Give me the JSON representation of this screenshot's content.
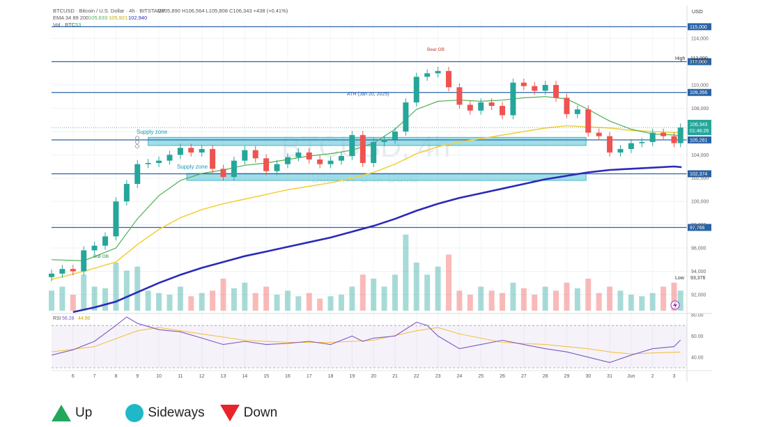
{
  "header": {
    "symbol_line": "BTCUSD · Bitcoin / U.S. Dollar · 4h · BITSTAMP",
    "ohlc": "O105,890  H106,564  L105,808  C106,343  +438 (+0.41%)",
    "ema_label": "EMA 34 89 200",
    "ema_values": [
      "105,633",
      "105,921",
      "102,940"
    ],
    "vol_label": "Vol · BTC",
    "vol_value": "53",
    "currency": "USD"
  },
  "watermark": {
    "main": "BTCUSD, 4h",
    "sub": "Bitcoin / U.S. Dollar"
  },
  "annotations": {
    "bear_ob": "Bear OB",
    "bull_ob": "Bull OB",
    "ath": "ATH (Jan 20, 2025)",
    "supply_zone_1": "Supply zone",
    "supply_zone_2": "Supply zone",
    "high_label": "High",
    "low_label": "Low"
  },
  "legend": {
    "up": "Up",
    "sideways": "Sideways",
    "down": "Down"
  },
  "colors": {
    "up_candle": "#26a69a",
    "down_candle": "#ef5350",
    "ema34": "#4caf50",
    "ema89": "#f4d03f",
    "ema200": "#2a2ab8",
    "level_line": "#2962a6",
    "zone_fill": "#7fd3e0",
    "rsi_line": "#7e57c2",
    "rsi_ma": "#f5c242",
    "legend_up": "#22a85a",
    "legend_sideways": "#1fb8c8",
    "legend_down": "#e8242a"
  },
  "chart_data": {
    "type": "line",
    "price_axis": {
      "ylim": [
        90500,
        115500
      ],
      "ticks": [
        92000,
        94000,
        96000,
        98000,
        100000,
        102000,
        104000,
        106000,
        108000,
        110000,
        112000,
        114000
      ],
      "tick_labels": [
        "92,000",
        "94,000",
        "96,000",
        "98,000",
        "100,000",
        "102,000",
        "104,000",
        "106,000",
        "108,000",
        "110,000",
        "112,000",
        "114,000"
      ]
    },
    "date_axis": {
      "labels": [
        "6",
        "7",
        "8",
        "9",
        "10",
        "11",
        "12",
        "13",
        "14",
        "15",
        "16",
        "17",
        "18",
        "19",
        "20",
        "21",
        "22",
        "23",
        "24",
        "25",
        "26",
        "27",
        "28",
        "29",
        "30",
        "31",
        "Jun",
        "2",
        "3"
      ]
    },
    "levels": [
      {
        "value": 115000,
        "label": "115,000"
      },
      {
        "value": 112000,
        "label": "112,000"
      },
      {
        "value": 109356,
        "label": "109,356"
      },
      {
        "value": 105281,
        "label": "105,281"
      },
      {
        "value": 102374,
        "label": "102,374"
      },
      {
        "value": 97766,
        "label": "97,766"
      }
    ],
    "right_labels": {
      "high_value": "112,000",
      "current_price": "106,343",
      "countdown": "01:46:26",
      "low_value": "93,376"
    },
    "zones": [
      {
        "name": "Supply zone",
        "from_day": 9.5,
        "to_day": 29.9,
        "low": 104800,
        "high": 105500
      },
      {
        "name": "Supply zone",
        "from_day": 11.3,
        "to_day": 29.9,
        "low": 101800,
        "high": 102400
      }
    ],
    "ema34_x": [
      5.0,
      6.5,
      8.0,
      9.0,
      10.0,
      11.0,
      12.0,
      13.0,
      14.0,
      15.0,
      16.0,
      17.0,
      18.0,
      19.0,
      20.0,
      21.0,
      22.0,
      23.0,
      24.0,
      25.0,
      26.0,
      27.0,
      28.0,
      29.0,
      30.0,
      31.0,
      32.0,
      33.0,
      34.0,
      34.35
    ],
    "ema34_y": [
      95000,
      94900,
      96000,
      98500,
      100500,
      101800,
      102400,
      102700,
      103100,
      103300,
      103600,
      103900,
      104100,
      104400,
      105000,
      106200,
      107900,
      108600,
      108700,
      108600,
      108700,
      108900,
      109000,
      108800,
      107900,
      106900,
      106200,
      105800,
      105700,
      105650
    ],
    "ema89_x": [
      5.0,
      6.5,
      8.0,
      9.0,
      10.0,
      11.0,
      12.0,
      13.0,
      14.0,
      15.0,
      16.0,
      17.0,
      18.0,
      19.0,
      20.0,
      21.0,
      22.0,
      23.0,
      24.0,
      25.0,
      26.0,
      27.0,
      28.0,
      29.0,
      30.0,
      31.0,
      32.0,
      33.0,
      34.0,
      34.35
    ],
    "ema89_y": [
      93300,
      94000,
      94800,
      96300,
      97600,
      98600,
      99300,
      99800,
      100200,
      100600,
      101000,
      101300,
      101600,
      102000,
      102500,
      103200,
      104100,
      104700,
      105100,
      105400,
      105700,
      106000,
      106300,
      106500,
      106400,
      106300,
      106100,
      106000,
      105920,
      105900
    ],
    "ema200_x": [
      6.0,
      7.0,
      8.0,
      9.0,
      10.0,
      11.0,
      12.0,
      13.0,
      14.0,
      15.0,
      16.0,
      17.0,
      18.0,
      19.0,
      20.0,
      21.0,
      22.0,
      23.0,
      24.0,
      25.0,
      26.0,
      27.0,
      28.0,
      29.0,
      30.0,
      31.0,
      32.0,
      33.0,
      34.0,
      34.35
    ],
    "ema200_y": [
      90500,
      90900,
      91400,
      92200,
      93000,
      93700,
      94300,
      94800,
      95300,
      95700,
      96100,
      96500,
      96900,
      97400,
      97900,
      98500,
      99200,
      99800,
      100300,
      100700,
      101100,
      101500,
      101900,
      102200,
      102500,
      102700,
      102800,
      102900,
      103000,
      102940
    ],
    "close_x": [
      5.0,
      5.5,
      6.0,
      6.5,
      7.0,
      7.5,
      8.0,
      8.5,
      9.0,
      9.5,
      10.0,
      10.5,
      11.0,
      11.5,
      12.0,
      12.5,
      13.0,
      13.5,
      14.0,
      14.5,
      15.0,
      15.5,
      16.0,
      16.5,
      17.0,
      17.5,
      18.0,
      18.5,
      19.0,
      19.5,
      20.0,
      20.5,
      21.0,
      21.5,
      22.0,
      22.5,
      23.0,
      23.5,
      24.0,
      24.5,
      25.0,
      25.5,
      26.0,
      26.5,
      27.0,
      27.5,
      28.0,
      28.5,
      29.0,
      29.5,
      30.0,
      30.5,
      31.0,
      31.5,
      32.0,
      32.5,
      33.0,
      33.5,
      34.0,
      34.3
    ],
    "close_y": [
      93800,
      94200,
      94000,
      95800,
      96200,
      97000,
      100000,
      101500,
      103200,
      103300,
      103500,
      104000,
      104600,
      104200,
      104500,
      102800,
      102100,
      103500,
      104400,
      103700,
      102600,
      103200,
      103800,
      104200,
      103600,
      103200,
      103500,
      103900,
      105700,
      103300,
      105100,
      105300,
      106000,
      108500,
      110700,
      111000,
      111200,
      109800,
      108300,
      107800,
      108500,
      108200,
      107400,
      110200,
      109900,
      109500,
      110000,
      108900,
      107500,
      107900,
      105900,
      105600,
      104200,
      104500,
      105000,
      105100,
      105900,
      105600,
      105000,
      106343
    ],
    "volume_x": [
      5.0,
      5.5,
      6.0,
      6.5,
      7.0,
      7.5,
      8.0,
      8.5,
      9.0,
      9.5,
      10.0,
      10.5,
      11.0,
      11.5,
      12.0,
      12.5,
      13.0,
      13.5,
      14.0,
      14.5,
      15.0,
      15.5,
      16.0,
      16.5,
      17.0,
      17.5,
      18.0,
      18.5,
      19.0,
      19.5,
      20.0,
      20.5,
      21.0,
      21.5,
      22.0,
      22.5,
      23.0,
      23.5,
      24.0,
      24.5,
      25.0,
      25.5,
      26.0,
      26.5,
      27.0,
      27.5,
      28.0,
      28.5,
      29.0,
      29.5,
      30.0,
      30.5,
      31.0,
      31.5,
      32.0,
      32.5,
      33.0,
      33.5,
      34.0,
      34.3
    ],
    "volume_y": [
      25,
      30,
      20,
      45,
      30,
      28,
      60,
      50,
      55,
      25,
      22,
      20,
      30,
      18,
      22,
      25,
      40,
      28,
      35,
      22,
      30,
      20,
      25,
      18,
      22,
      15,
      18,
      20,
      30,
      45,
      40,
      30,
      45,
      95,
      60,
      45,
      55,
      70,
      25,
      20,
      30,
      25,
      22,
      35,
      28,
      20,
      30,
      25,
      35,
      28,
      40,
      22,
      30,
      25,
      20,
      18,
      22,
      30,
      35,
      25
    ],
    "rsi_axis": {
      "ylim": [
        30,
        80
      ],
      "ticks": [
        40,
        60,
        80
      ],
      "tick_labels": [
        "40.00",
        "60.00",
        "80.00"
      ],
      "upper_band": 70,
      "lower_band": 30
    },
    "rsi_label": "RSI",
    "rsi_values": [
      "56.28",
      "44.90"
    ],
    "rsi_x": [
      5.0,
      6.0,
      7.0,
      8.0,
      8.5,
      9.0,
      10.0,
      11.0,
      12.0,
      13.0,
      14.0,
      15.0,
      16.0,
      17.0,
      18.0,
      19.0,
      19.5,
      20.0,
      21.0,
      22.0,
      22.5,
      23.0,
      24.0,
      25.0,
      26.0,
      27.0,
      28.0,
      29.0,
      30.0,
      31.0,
      32.0,
      33.0,
      34.0,
      34.3
    ],
    "rsi_y": [
      42,
      47,
      55,
      70,
      78,
      72,
      66,
      64,
      58,
      52,
      55,
      52,
      53,
      55,
      52,
      60,
      55,
      58,
      60,
      73,
      70,
      60,
      48,
      52,
      56,
      52,
      48,
      45,
      40,
      35,
      42,
      48,
      50,
      56.28
    ],
    "rsi_ma_x": [
      5.0,
      7.0,
      9.0,
      10.0,
      12.0,
      14.0,
      16.0,
      18.0,
      20.0,
      22.0,
      23.0,
      24.0,
      26.0,
      28.0,
      30.0,
      31.0,
      32.0,
      33.0,
      34.3
    ],
    "rsi_ma_y": [
      45,
      50,
      65,
      68,
      62,
      56,
      54,
      54,
      56,
      65,
      68,
      62,
      54,
      52,
      48,
      45,
      43,
      44,
      44.9
    ]
  }
}
